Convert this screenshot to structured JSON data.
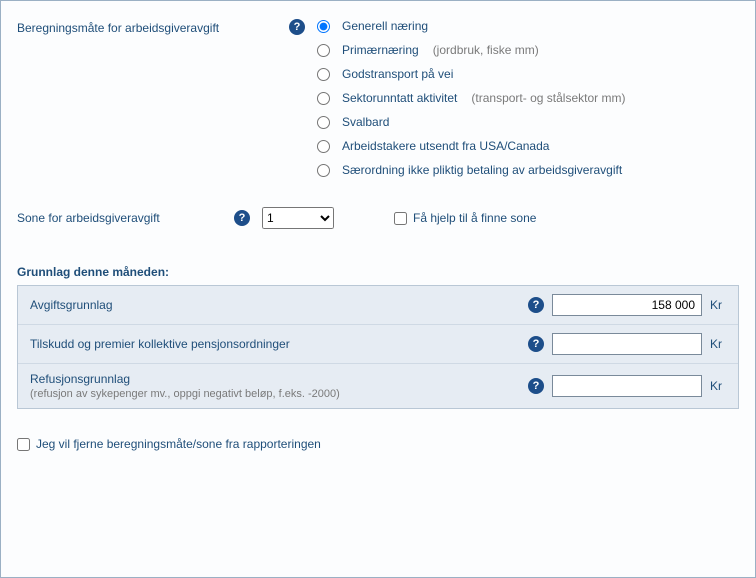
{
  "calcMethod": {
    "label": "Beregningsmåte for arbeidsgiveravgift",
    "options": [
      {
        "label": "Generell næring",
        "hint": ""
      },
      {
        "label": "Primærnæring",
        "hint": "(jordbruk, fiske mm)"
      },
      {
        "label": "Godstransport på vei",
        "hint": ""
      },
      {
        "label": "Sektorunntatt aktivitet",
        "hint": "(transport- og stålsektor mm)"
      },
      {
        "label": "Svalbard",
        "hint": ""
      },
      {
        "label": "Arbeidstakere utsendt fra USA/Canada",
        "hint": ""
      },
      {
        "label": "Særordning ikke pliktig betaling av arbeidsgiveravgift",
        "hint": ""
      }
    ],
    "selected": 0
  },
  "zone": {
    "label": "Sone for arbeidsgiveravgift",
    "selected": "1",
    "options": [
      "1"
    ],
    "findHelp": "Få hjelp til å finne sone"
  },
  "basis": {
    "heading": "Grunnlag denne måneden:",
    "rows": [
      {
        "label": "Avgiftsgrunnlag",
        "sub": "",
        "value": "158 000"
      },
      {
        "label": "Tilskudd og premier kollektive pensjonsordninger",
        "sub": "",
        "value": ""
      },
      {
        "label": "Refusjonsgrunnlag",
        "sub": "(refusjon av sykepenger mv., oppgi negativt beløp, f.eks. -2000)",
        "value": ""
      }
    ],
    "currency": "Kr"
  },
  "remove": {
    "label": "Jeg vil fjerne beregningsmåte/sone fra rapporteringen"
  }
}
